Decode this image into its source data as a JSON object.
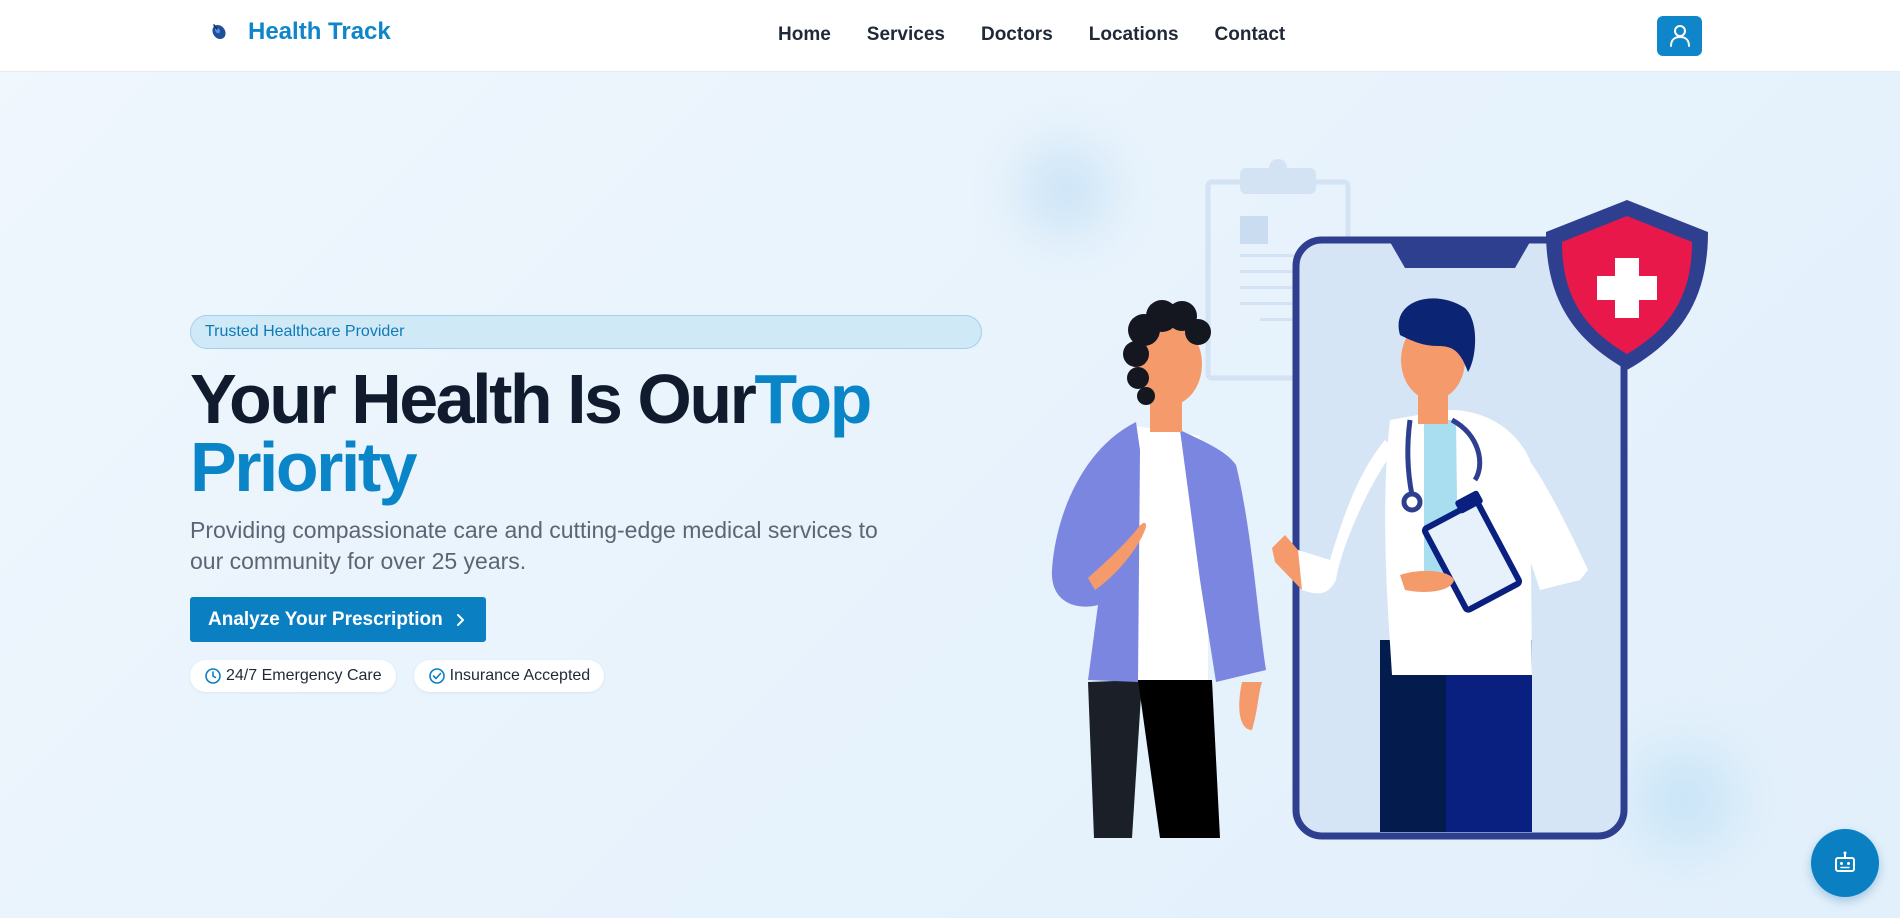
{
  "brand": {
    "name": "Health Track",
    "icon": "stethoscope-icon"
  },
  "nav": {
    "items": [
      "Home",
      "Services",
      "Doctors",
      "Locations",
      "Contact"
    ]
  },
  "header": {
    "user_icon": "user-icon"
  },
  "hero": {
    "badge": "Trusted Healthcare Provider",
    "headline_main": "Your Health Is Our",
    "headline_accent_1": "Top",
    "headline_accent_2": "Priority",
    "subtext": "Providing compassionate care and cutting-edge medical services to our community for over 25 years.",
    "cta_label": "Analyze Your Prescription",
    "cta_icon": "chevron-right-icon",
    "features": [
      {
        "label": "24/7 Emergency Care",
        "icon": "clock-icon"
      },
      {
        "label": "Insurance Accepted",
        "icon": "check-circle-icon"
      }
    ]
  },
  "chat": {
    "icon": "robot-icon"
  },
  "colors": {
    "accent": "#0a86c8",
    "headline": "#111b2e",
    "shield": "#e8194a",
    "phone_frame": "#2f3f8f",
    "jacket": "#7b86e0"
  }
}
